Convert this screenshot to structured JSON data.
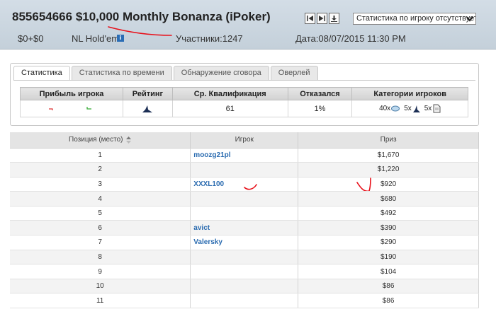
{
  "header": {
    "title": "855654666 $10,000 Monthly Bonanza (iPoker)",
    "buyin": "$0+$0",
    "game": "NL Hold'em",
    "info_icon_text": "i",
    "participants": "Участники:1247",
    "date": "Дата:08/07/2015 11:30 PM",
    "stats_select_value": "Статистика по игроку отсутствует"
  },
  "tabs": [
    {
      "label": "Статистика",
      "active": true
    },
    {
      "label": "Статистика по времени",
      "active": false
    },
    {
      "label": "Обнаружение сговора",
      "active": false
    },
    {
      "label": "Оверлей",
      "active": false
    }
  ],
  "stats": {
    "headers": [
      "Прибыль игрока",
      "Рейтинг",
      "Ср. Квалификация",
      "Отказался",
      "Категории игроков"
    ],
    "avg_qualification": "61",
    "refused": "1%",
    "categories": [
      {
        "count": "40x",
        "icon": "fish-icon"
      },
      {
        "count": "5x",
        "icon": "shark-icon"
      },
      {
        "count": "5x",
        "icon": "paper-icon"
      }
    ]
  },
  "results": {
    "headers": [
      "Позиция (место)",
      "Игрок",
      "Приз"
    ],
    "rows": [
      {
        "position": "1",
        "player": "moozg21pl",
        "prize": "$1,670"
      },
      {
        "position": "2",
        "player": "",
        "prize": "$1,220"
      },
      {
        "position": "3",
        "player": "XXXL100",
        "prize": "$920"
      },
      {
        "position": "4",
        "player": "",
        "prize": "$680"
      },
      {
        "position": "5",
        "player": "",
        "prize": "$492"
      },
      {
        "position": "6",
        "player": "avict",
        "prize": "$390"
      },
      {
        "position": "7",
        "player": "Valersky",
        "prize": "$290"
      },
      {
        "position": "8",
        "player": "",
        "prize": "$190"
      },
      {
        "position": "9",
        "player": "",
        "prize": "$104"
      },
      {
        "position": "10",
        "player": "",
        "prize": "$86"
      },
      {
        "position": "11",
        "player": "",
        "prize": "$86"
      }
    ]
  },
  "colors": {
    "header_bg": "#c9d4de",
    "link": "#2a6bb0",
    "annotation_red": "#e8101a"
  }
}
